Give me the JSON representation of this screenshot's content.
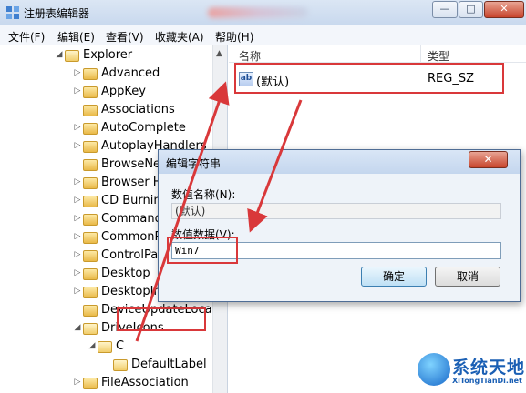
{
  "window": {
    "title": "注册表编辑器",
    "min_glyph": "—",
    "max_glyph": "□",
    "close_glyph": "✕"
  },
  "menu": {
    "items": [
      "文件(F)",
      "编辑(E)",
      "查看(V)",
      "收藏夹(A)",
      "帮助(H)"
    ]
  },
  "tree": {
    "items": [
      {
        "label": "Explorer",
        "expand": "◢",
        "open": true
      },
      {
        "label": "Advanced",
        "expand": "▷"
      },
      {
        "label": "AppKey",
        "expand": "▷"
      },
      {
        "label": "Associations",
        "expand": ""
      },
      {
        "label": "AutoComplete",
        "expand": "▷"
      },
      {
        "label": "AutoplayHandlers",
        "expand": "▷"
      },
      {
        "label": "BrowseNewProcess",
        "expand": ""
      },
      {
        "label": "Browser Helper Objects",
        "expand": "▷"
      },
      {
        "label": "CD Burning",
        "expand": "▷"
      },
      {
        "label": "CommandStore",
        "expand": "▷"
      },
      {
        "label": "CommonPlaces",
        "expand": "▷"
      },
      {
        "label": "ControlPanel",
        "expand": "▷"
      },
      {
        "label": "Desktop",
        "expand": "▷"
      },
      {
        "label": "DesktopIni",
        "expand": "▷"
      },
      {
        "label": "DeviceUpdateLocations",
        "expand": ""
      },
      {
        "label": "DriveIcons",
        "expand": "◢",
        "open": true
      },
      {
        "label": "C",
        "expand": "◢",
        "open": true
      },
      {
        "label": "DefaultLabel",
        "expand": "",
        "open": true
      },
      {
        "label": "FileAssociation",
        "expand": "▷"
      }
    ]
  },
  "list": {
    "col_name": "名称",
    "col_type": "类型",
    "rows": [
      {
        "icon": "ab",
        "name": "(默认)",
        "type": "REG_SZ"
      }
    ]
  },
  "dialog": {
    "title": "编辑字符串",
    "name_label": "数值名称(N):",
    "name_value": "(默认)",
    "data_label": "数值数据(V):",
    "data_value": "Win7",
    "ok": "确定",
    "cancel": "取消",
    "close_glyph": "✕"
  },
  "watermark": {
    "text": "系统天地",
    "url": "XiTongTianDi.net"
  },
  "colors": {
    "highlight_red": "#d9383a",
    "window_blue": "#c9d9ee"
  }
}
